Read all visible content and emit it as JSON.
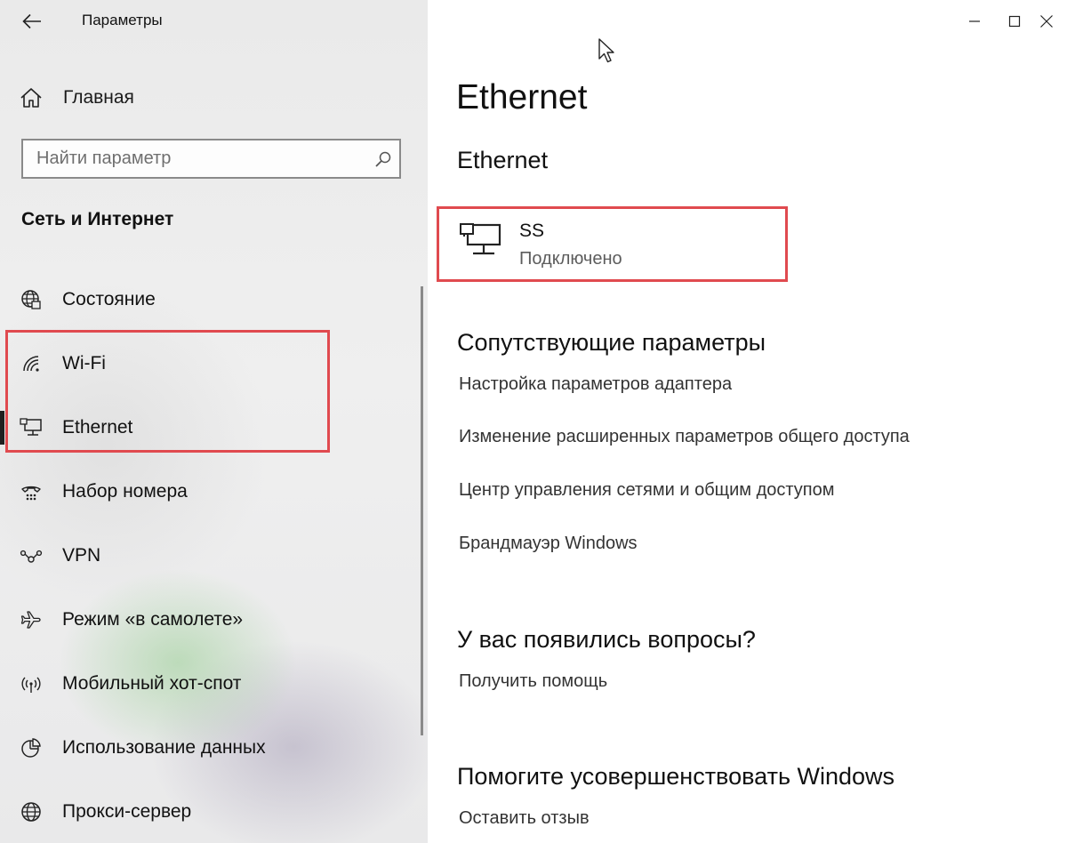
{
  "window": {
    "title": "Параметры",
    "controls": {
      "minimize": "minimize",
      "maximize": "maximize",
      "close": "close"
    }
  },
  "sidebar": {
    "home_label": "Главная",
    "search_placeholder": "Найти параметр",
    "section_title": "Сеть и Интернет",
    "items": [
      {
        "label": "Состояние",
        "icon": "globe-status-icon"
      },
      {
        "label": "Wi-Fi",
        "icon": "wifi-icon"
      },
      {
        "label": "Ethernet",
        "icon": "ethernet-icon",
        "selected": true
      },
      {
        "label": "Набор номера",
        "icon": "dialup-icon"
      },
      {
        "label": "VPN",
        "icon": "vpn-icon"
      },
      {
        "label": "Режим «в самолете»",
        "icon": "airplane-icon"
      },
      {
        "label": "Мобильный хот-спот",
        "icon": "hotspot-icon"
      },
      {
        "label": "Использование данных",
        "icon": "data-usage-icon"
      },
      {
        "label": "Прокси-сервер",
        "icon": "globe-icon"
      }
    ]
  },
  "main": {
    "page_title": "Ethernet",
    "section_title": "Ethernet",
    "connection": {
      "name": "SS",
      "status": "Подключено",
      "icon": "ethernet-network-icon"
    },
    "related": {
      "title": "Сопутствующие параметры",
      "links": [
        "Настройка параметров адаптера",
        "Изменение расширенных параметров общего доступа",
        "Центр управления сетями и общим доступом",
        "Брандмауэр Windows"
      ]
    },
    "questions": {
      "title": "У вас появились вопросы?",
      "link": "Получить помощь"
    },
    "feedback": {
      "title": "Помогите усовершенствовать Windows",
      "link": "Оставить отзыв"
    }
  },
  "colors": {
    "highlight": "#e04a4f",
    "sidebar_bg": "#ececec",
    "text": "#111111",
    "muted": "#5d5d5d"
  }
}
